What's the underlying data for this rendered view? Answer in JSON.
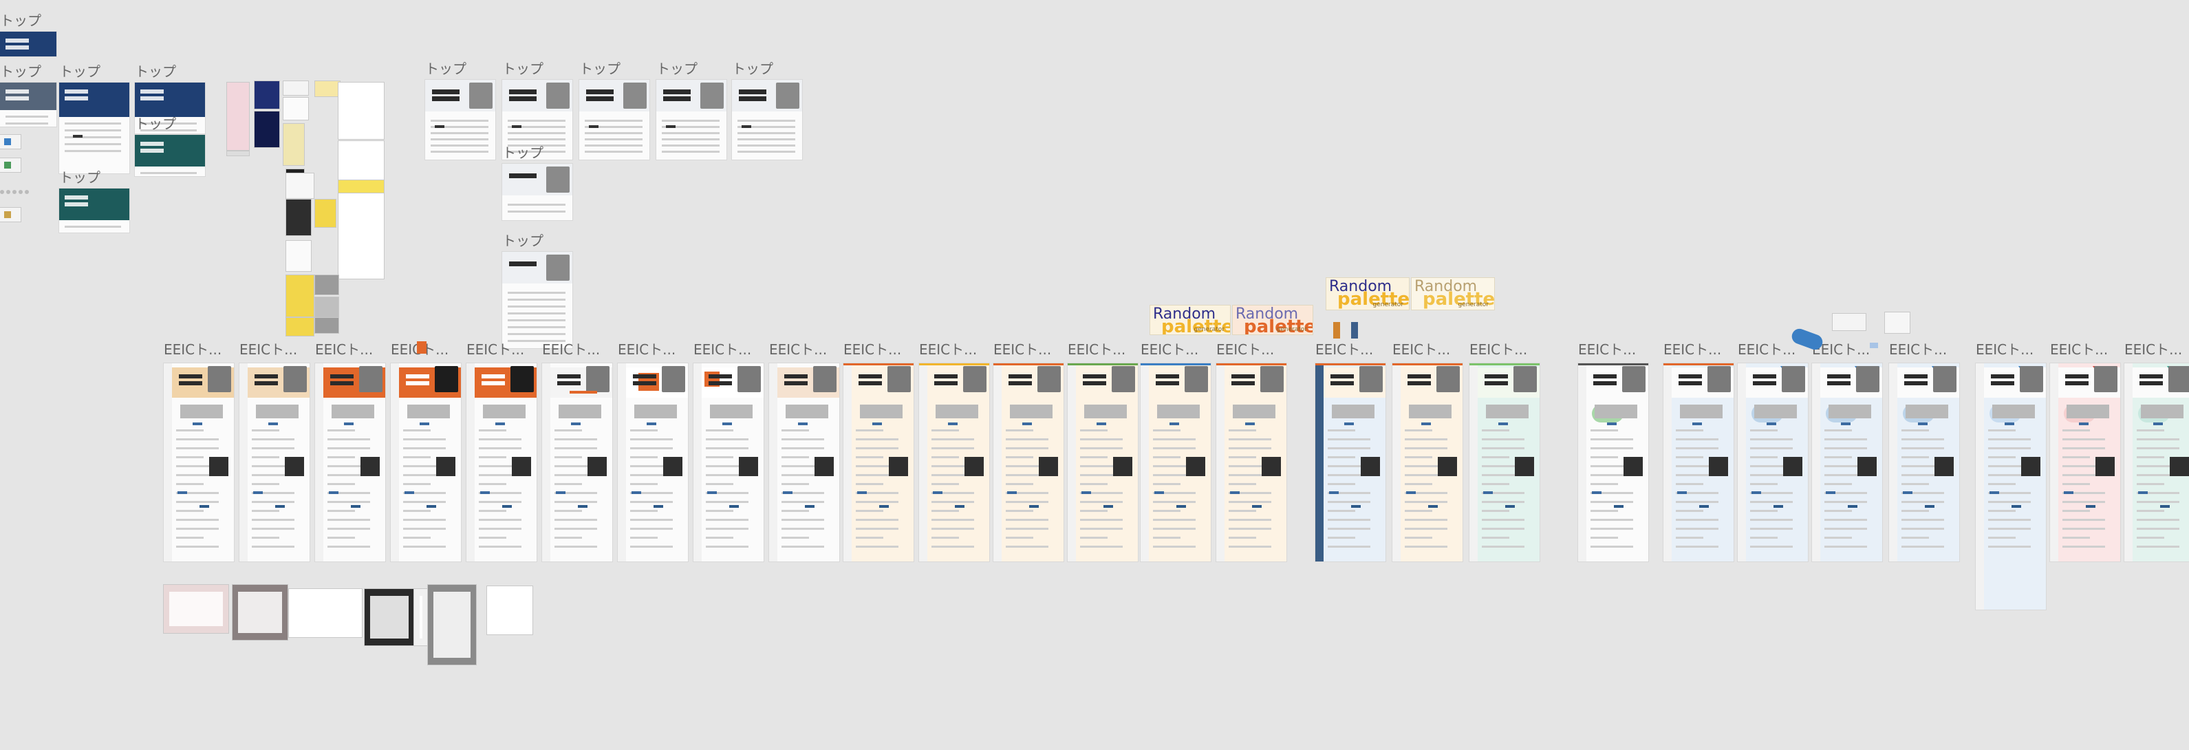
{
  "canvas": {
    "label_top": "トップ",
    "label_eeic": "EEICト...",
    "random_palette": {
      "line1": "Random",
      "line2": "palette",
      "line3": "generator"
    },
    "colors": {
      "background": "#e5e5e5",
      "frame": "#fbfbfb",
      "navy_hero": "#1f3f73",
      "teal_hero": "#1d5b5b",
      "orange": "#e2672a",
      "yellow": "#f1b52c",
      "blue_accent": "#3b7fc4",
      "red_accent": "#d8453c",
      "green_accent": "#3aa690"
    }
  }
}
